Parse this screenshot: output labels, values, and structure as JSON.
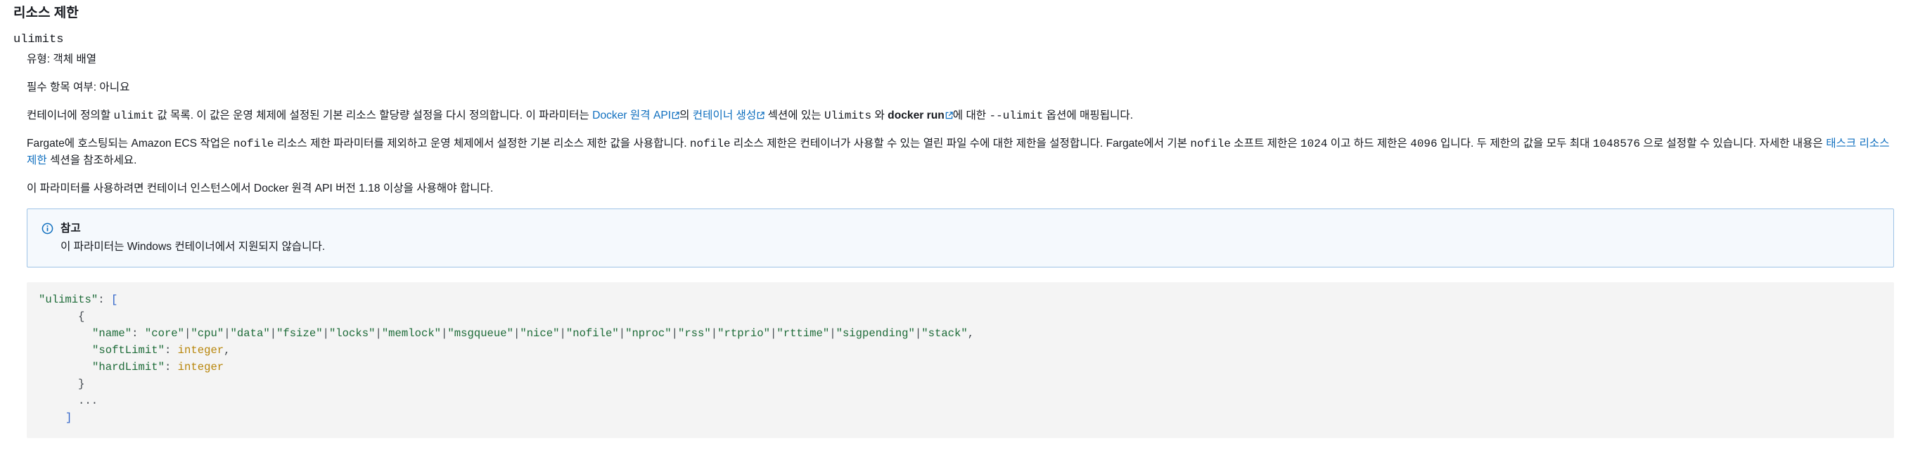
{
  "section": {
    "title": "리소스 제한",
    "param_name": "ulimits",
    "type_line": "유형: 객체 배열",
    "required_line": "필수 항목 여부: 아니요"
  },
  "para1": {
    "t1": "컨테이너에 정의할 ",
    "code1": "ulimit",
    "t2": " 값 목록. 이 값은 운영 체제에 설정된 기본 리소스 할당량 설정을 다시 정의합니다. 이 파라미터는 ",
    "link1": "Docker 원격 API",
    "t3": "의 ",
    "link2": "컨테이너 생성",
    "t4": " 섹션에 있는 ",
    "code2": "Ulimits",
    "t5": " 와 ",
    "bold1": "docker run",
    "t6": "에 대한 ",
    "code3": "--ulimit",
    "t7": " 옵션에 매핑됩니다."
  },
  "para2": {
    "t1": "Fargate에 호스팅되는 Amazon ECS 작업은 ",
    "code1": "nofile",
    "t2": " 리소스 제한 파라미터를 제외하고 운영 체제에서 설정한 기본 리소스 제한 값을 사용합니다. ",
    "code2": "nofile",
    "t3": " 리소스 제한은 컨테이너가 사용할 수 있는 열린 파일 수에 대한 제한을 설정합니다. Fargate에서 기본 ",
    "code3": "nofile",
    "t4": " 소프트 제한은 ",
    "code4": "1024",
    "t5": " 이고 하드 제한은 ",
    "code5": "4096",
    "t6": " 입니다. 두 제한의 값을 모두 최대 ",
    "code6": "1048576",
    "t7": " 으로 설정할 수 있습니다. 자세한 내용은 ",
    "link1": "태스크 리소스 제한",
    "t8": " 섹션을 참조하세요."
  },
  "para3": "이 파라미터를 사용하려면 컨테이너 인스턴스에서 Docker 원격 API 버전 1.18 이상을 사용해야 합니다.",
  "note": {
    "title": "참고",
    "text": "이 파라미터는 Windows 컨테이너에서 지원되지 않습니다.",
    "icon": "info-icon"
  },
  "code": {
    "key_ulimits": "\"ulimits\"",
    "colon": ": ",
    "open_bracket": "[",
    "open_brace": "{",
    "key_name": "\"name\"",
    "name_values": [
      "\"core\"",
      "\"cpu\"",
      "\"data\"",
      "\"fsize\"",
      "\"locks\"",
      "\"memlock\"",
      "\"msgqueue\"",
      "\"nice\"",
      "\"nofile\"",
      "\"nproc\"",
      "\"rss\"",
      "\"rtprio\"",
      "\"rttime\"",
      "\"sigpending\"",
      "\"stack\""
    ],
    "key_soft": "\"softLimit\"",
    "key_hard": "\"hardLimit\"",
    "type_integer": "integer",
    "close_brace": "}",
    "ellipsis": "...",
    "close_bracket": "]"
  },
  "colors": {
    "link": "#0f6fbf",
    "note_border": "#9ec3e6",
    "note_bg": "#f5f9fd"
  }
}
